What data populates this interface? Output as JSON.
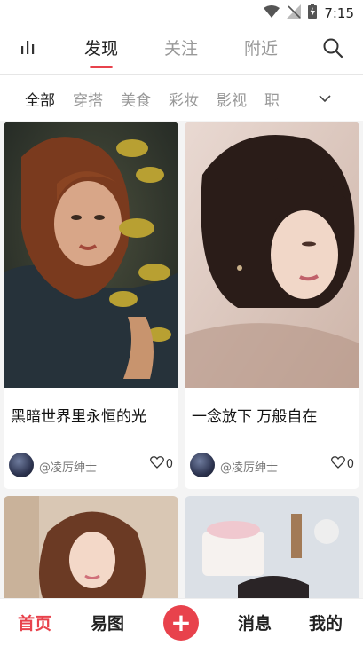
{
  "status_bar": {
    "time": "7:15"
  },
  "top_nav": {
    "tabs": [
      "发现",
      "关注",
      "附近"
    ],
    "active_tab": "发现"
  },
  "categories": {
    "items": [
      "全部",
      "穿搭",
      "美食",
      "彩妆",
      "影视",
      "职"
    ],
    "active": "全部"
  },
  "feed": [
    {
      "title": "黑暗世界里永恒的光",
      "author": "@凌厉绅士",
      "likes": "0"
    },
    {
      "title": "一念放下 万般自在",
      "author": "@凌厉绅士",
      "likes": "0"
    }
  ],
  "bottom_nav": {
    "items": [
      "首页",
      "易图",
      "+",
      "消息",
      "我的"
    ],
    "active": "首页"
  },
  "colors": {
    "accent": "#e8424c"
  }
}
